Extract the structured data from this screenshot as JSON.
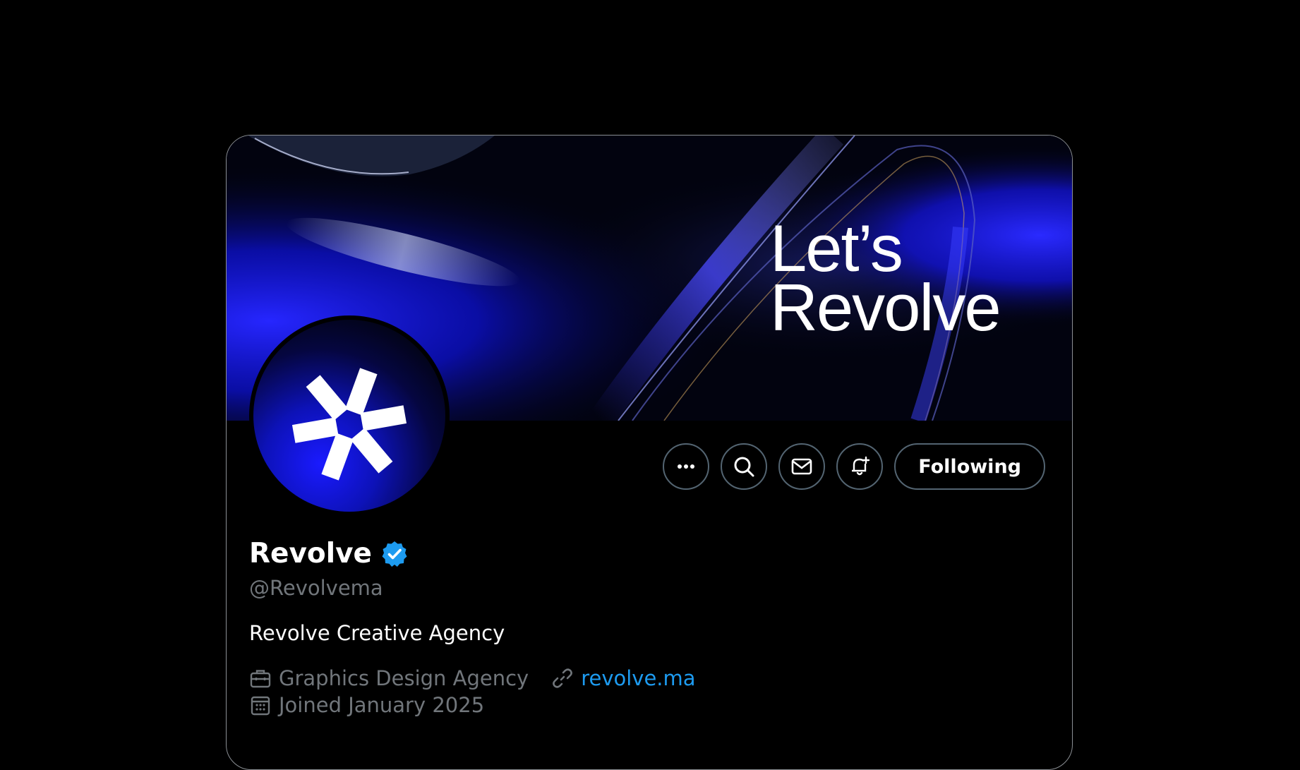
{
  "profile": {
    "banner_text_line1": "Let’s",
    "banner_text_line2": "Revolve",
    "name": "Revolve",
    "handle": "@Revolvema",
    "bio": "Revolve Creative Agency",
    "category": "Graphics Design Agency",
    "website": "revolve.ma",
    "joined": "Joined January 2025",
    "verified": true
  },
  "actions": {
    "more_icon": "more-dots-icon",
    "search_icon": "search-icon",
    "message_icon": "envelope-icon",
    "notify_icon": "bell-plus-icon",
    "follow_label": "Following"
  },
  "colors": {
    "accent_link": "#1d9bf0",
    "verified_badge": "#1d9bf0",
    "banner_blue": "#1a1aff",
    "secondary_text": "#71767b",
    "button_border": "#536471"
  }
}
